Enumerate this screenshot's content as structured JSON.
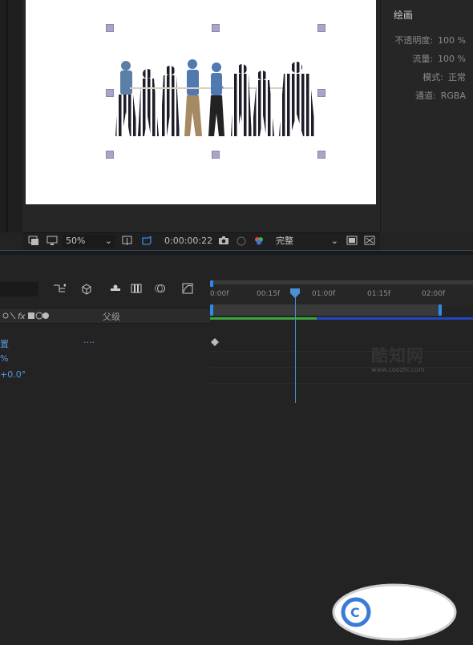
{
  "paint_panel": {
    "title": "绘画",
    "properties": [
      {
        "label": "不透明度:",
        "value": "100 %"
      },
      {
        "label": "流量:",
        "value": "100 %"
      },
      {
        "label": "模式:",
        "value": "正常"
      },
      {
        "label": "通道:",
        "value": "RGBA"
      }
    ]
  },
  "viewer": {
    "zoom": "50%",
    "timecode": "0:00:00:22",
    "resolution": "完整"
  },
  "timeline": {
    "ruler_labels": [
      "0:00f",
      "00:15f",
      "01:00f",
      "01:15f",
      "02:00f"
    ],
    "column_header": {
      "fx": "fx",
      "parent": "父级"
    },
    "layers": [
      {
        "name": "置",
        "value": "....",
        "marker": "diamond"
      },
      {
        "name": "%",
        "value": ""
      },
      {
        "name": "+0.0°",
        "value": ""
      }
    ]
  },
  "watermark": {
    "brand": "酷知网",
    "url": "www.coozhi.com"
  },
  "colors": {
    "accent": "#2d8ceb",
    "panel": "#232323",
    "canvas": "#ffffff",
    "layer_text": "#5b9ad8"
  }
}
